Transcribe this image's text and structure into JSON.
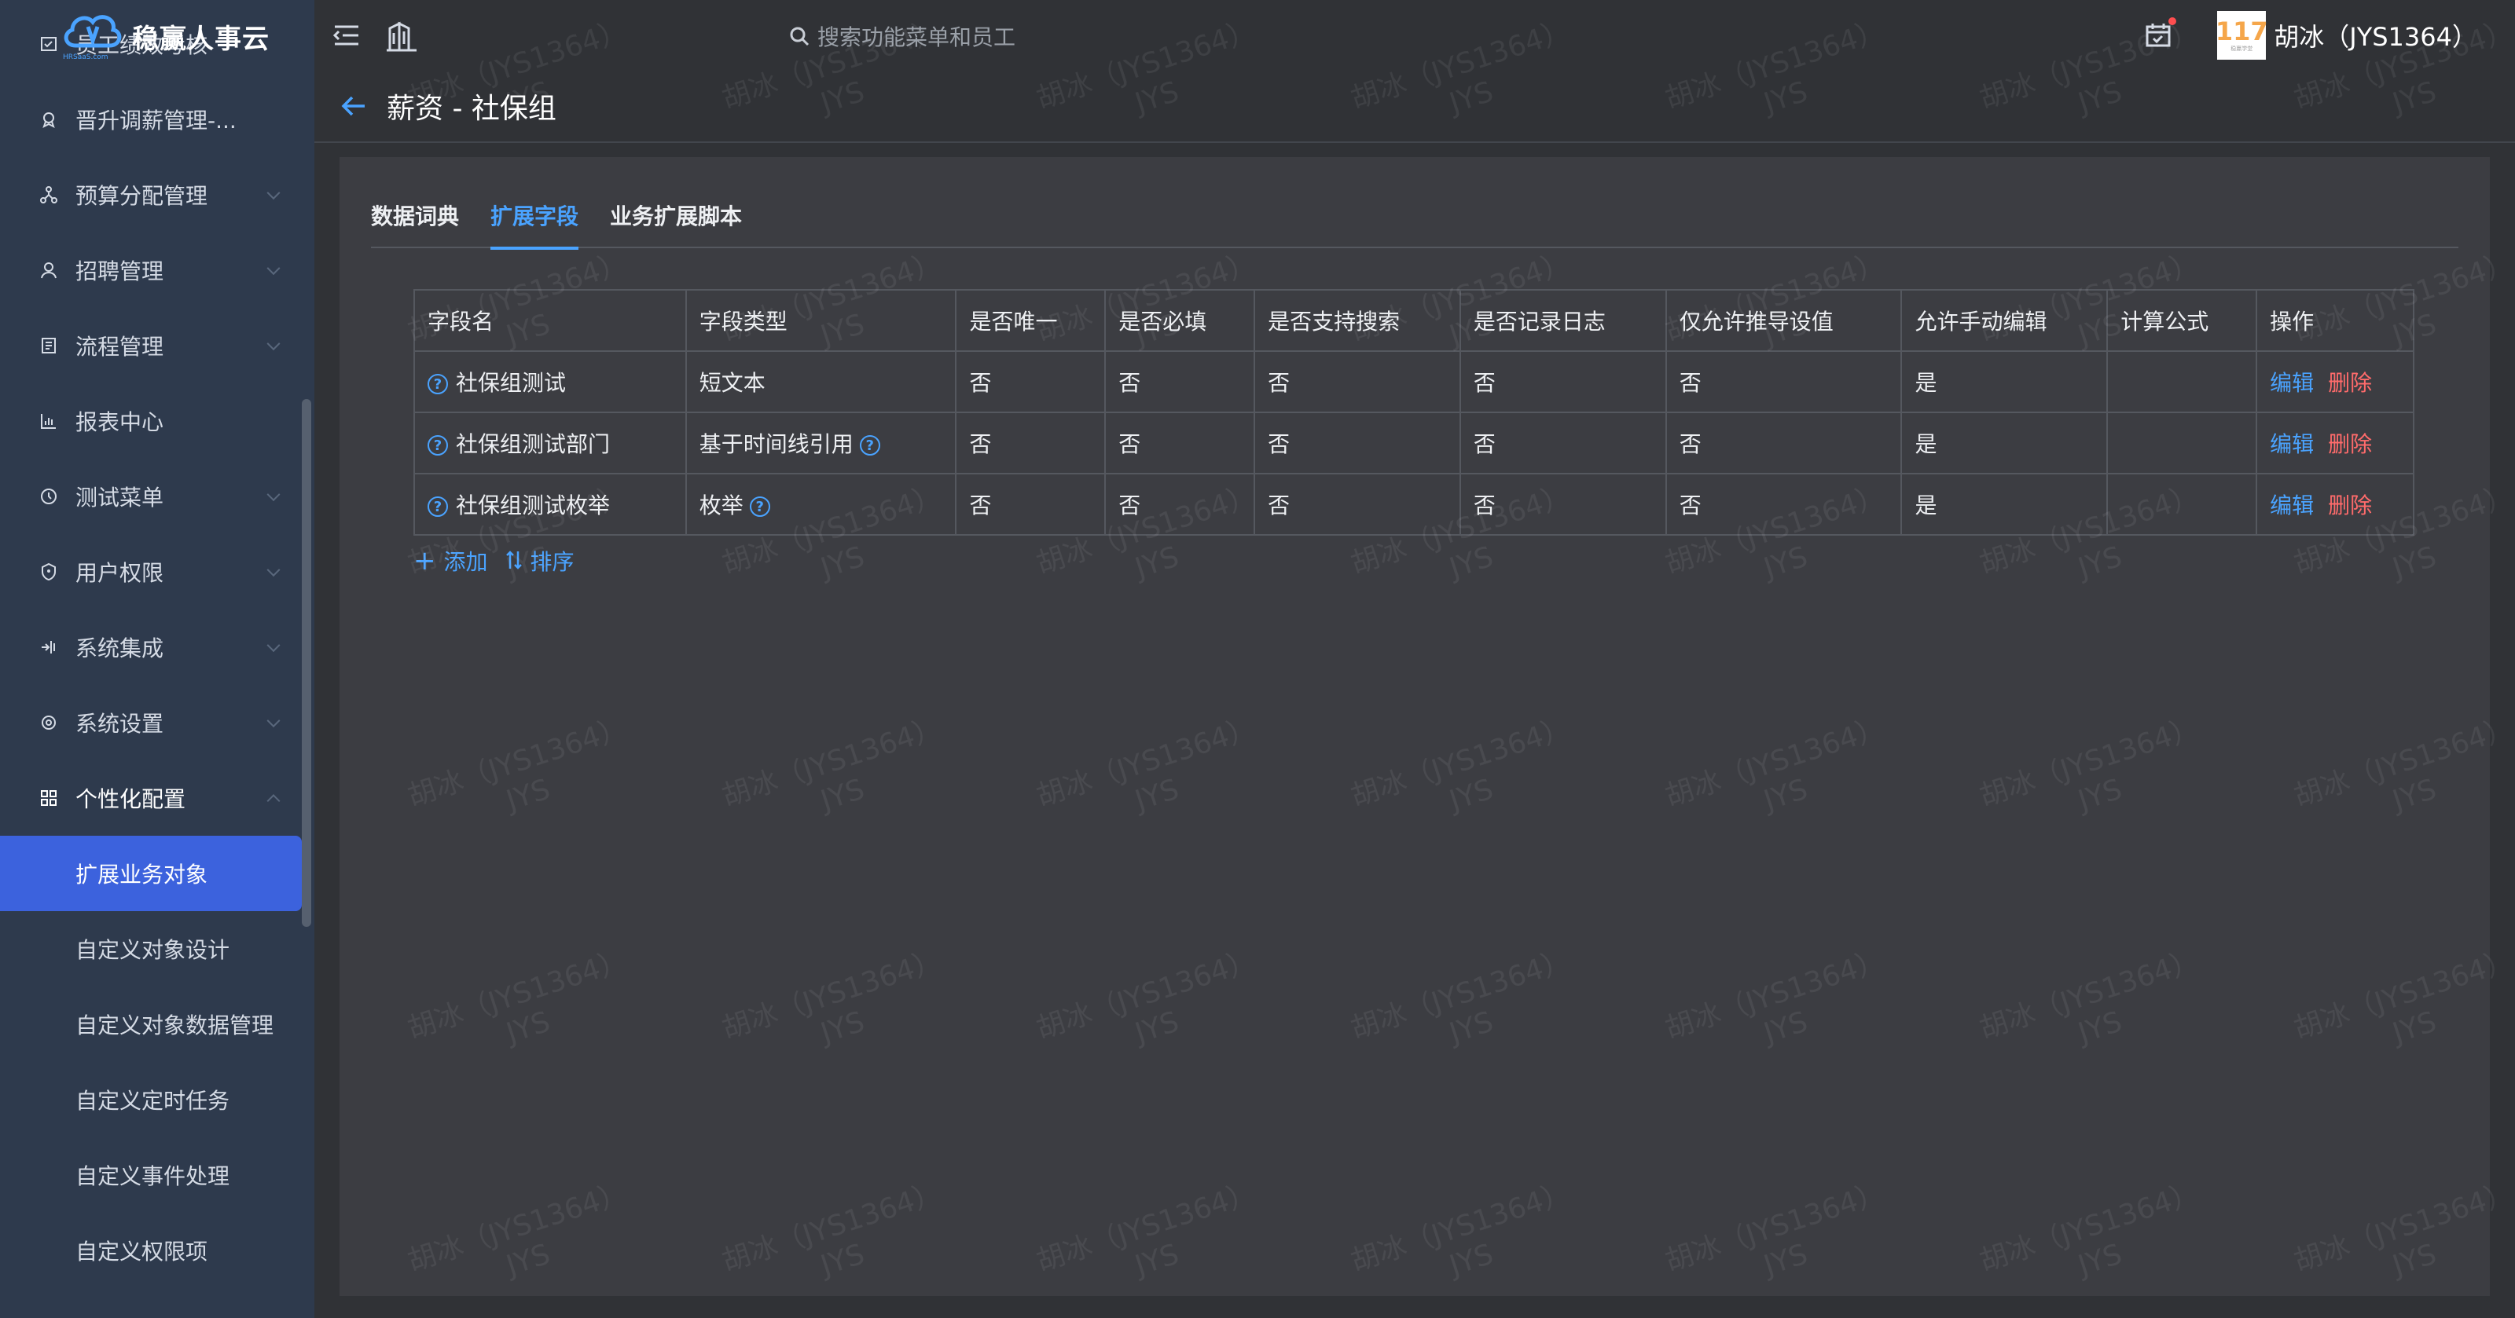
{
  "brand": {
    "name": "稳赢人事云",
    "sub": "HRSaaS.com"
  },
  "sidebar": {
    "items": [
      {
        "label": "员工绩效考核",
        "icon": "checklist-icon"
      },
      {
        "label": "晋升调薪管理-...",
        "icon": "award-icon"
      },
      {
        "label": "预算分配管理",
        "icon": "network-icon"
      },
      {
        "label": "招聘管理",
        "icon": "person-icon"
      },
      {
        "label": "流程管理",
        "icon": "document-icon"
      },
      {
        "label": "报表中心",
        "icon": "chart-icon"
      },
      {
        "label": "测试菜单",
        "icon": "clock-icon"
      },
      {
        "label": "用户权限",
        "icon": "shield-icon"
      },
      {
        "label": "系统集成",
        "icon": "plug-icon"
      },
      {
        "label": "系统设置",
        "icon": "gear-icon"
      }
    ],
    "group": {
      "label": "个性化配置",
      "icon": "grid-icon"
    },
    "sub_items": [
      {
        "label": "扩展业务对象",
        "active": true
      },
      {
        "label": "自定义对象设计"
      },
      {
        "label": "自定义对象数据管理"
      },
      {
        "label": "自定义定时任务"
      },
      {
        "label": "自定义事件处理"
      },
      {
        "label": "自定义权限项"
      }
    ]
  },
  "topbar": {
    "search_placeholder": "搜索功能菜单和员工",
    "avatar_number": "117",
    "avatar_caption": "稳赢学堂",
    "username": "胡冰（JYS1364）"
  },
  "page": {
    "title": "薪资 - 社保组"
  },
  "tabs": [
    {
      "label": "数据词典",
      "active": false
    },
    {
      "label": "扩展字段",
      "active": true
    },
    {
      "label": "业务扩展脚本",
      "active": false
    }
  ],
  "table": {
    "headers": [
      "字段名",
      "字段类型",
      "是否唯一",
      "是否必填",
      "是否支持搜索",
      "是否记录日志",
      "仅允许推导设值",
      "允许手动编辑",
      "计算公式",
      "操作"
    ],
    "rows": [
      {
        "name": "社保组测试",
        "type": "短文本",
        "type_help": false,
        "unique": "否",
        "required": "否",
        "searchable": "否",
        "logged": "否",
        "derived_only": "否",
        "manual_edit": "是",
        "formula": ""
      },
      {
        "name": "社保组测试部门",
        "type": "基于时间线引用",
        "type_help": true,
        "unique": "否",
        "required": "否",
        "searchable": "否",
        "logged": "否",
        "derived_only": "否",
        "manual_edit": "是",
        "formula": ""
      },
      {
        "name": "社保组测试枚举",
        "type": "枚举",
        "type_help": true,
        "unique": "否",
        "required": "否",
        "searchable": "否",
        "logged": "否",
        "derived_only": "否",
        "manual_edit": "是",
        "formula": ""
      }
    ],
    "edit_label": "编辑",
    "delete_label": "删除"
  },
  "actions": {
    "add_label": "添加",
    "sort_label": "排序"
  },
  "watermark": {
    "line1": "胡冰（JYS1364）",
    "line2": "JYS"
  },
  "colors": {
    "accent": "#4aa3ff",
    "danger": "#ff6b6b",
    "sidebar_bg": "#2e3a4d",
    "active_item": "#3c62dd"
  }
}
